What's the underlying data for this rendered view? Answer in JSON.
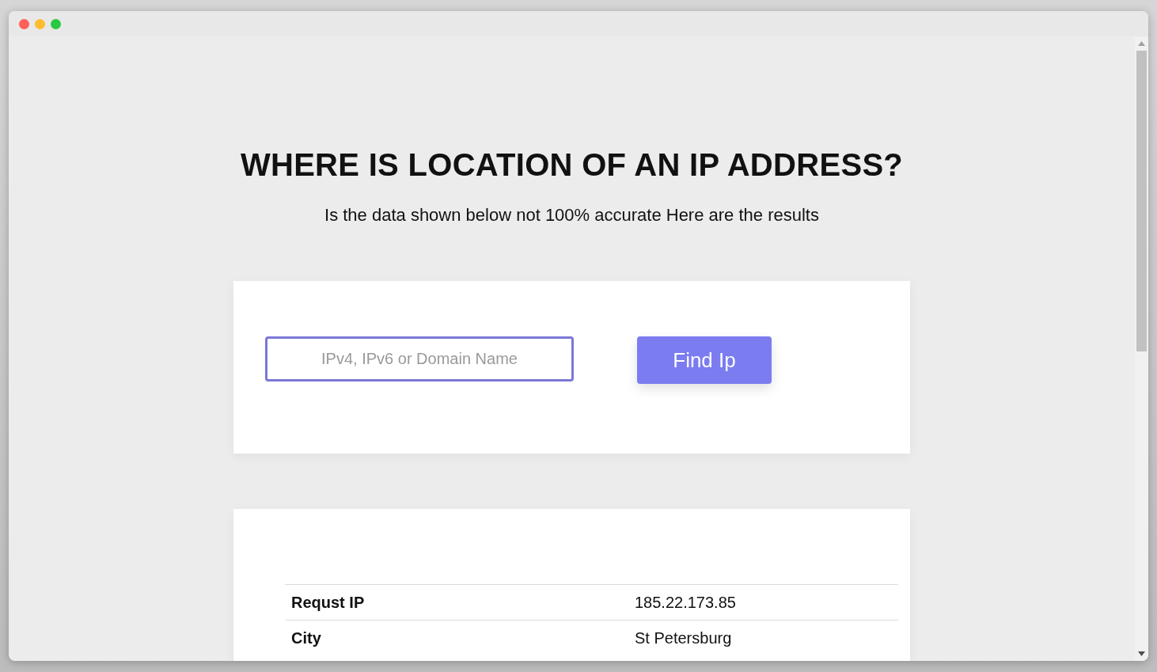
{
  "heading": "WHERE IS LOCATION OF AN IP ADDRESS?",
  "subtitle": "Is the data shown below not 100% accurate Here are the results",
  "search": {
    "placeholder": "IPv4, IPv6 or Domain Name"
  },
  "button": "Find Ip",
  "results": [
    {
      "label": "Requst IP",
      "value": "185.22.173.85"
    },
    {
      "label": "City",
      "value": "St Petersburg"
    }
  ]
}
